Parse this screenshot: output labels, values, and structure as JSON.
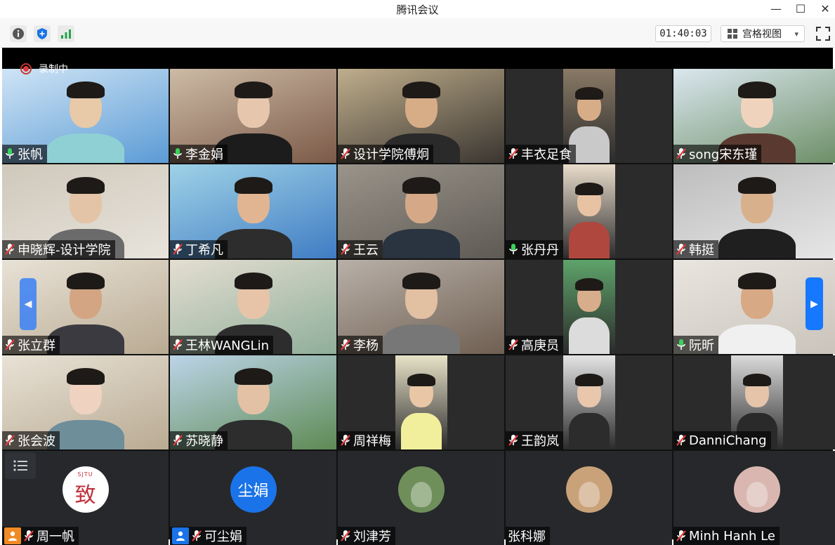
{
  "window": {
    "title": "腾讯会议",
    "minimize": "—",
    "maximize": "☐",
    "close": "✕"
  },
  "toolbar": {
    "timer": "01:40:03",
    "view_label": "宫格视图",
    "view_caret": "▾"
  },
  "recording": {
    "label": "录制中"
  },
  "participants": [
    {
      "name": "张帆",
      "mic": "on",
      "bg": "#5b9bd5",
      "bg2": "#cfe4f5",
      "skin": "#e8c9a8",
      "shirt": "#8fd0d4",
      "type": "video"
    },
    {
      "name": "李金娟",
      "mic": "on",
      "bg": "#7b5a48",
      "bg2": "#cdbba6",
      "skin": "#e6c7ae",
      "shirt": "#1c1c1c",
      "type": "video"
    },
    {
      "name": "设计学院傅炯",
      "mic": "off",
      "bg": "#3a3530",
      "bg2": "#bfae8c",
      "skin": "#d7ad88",
      "shirt": "#2a2a2a",
      "type": "video"
    },
    {
      "name": "丰衣足食",
      "mic": "off",
      "bg": "#2b2b2b",
      "bg2": "#8a7a66",
      "skin": "#d7ad88",
      "shirt": "#c9c9c9",
      "type": "narrow"
    },
    {
      "name": "song宋东瑾",
      "mic": "off",
      "bg": "#6c8e66",
      "bg2": "#dbe7ef",
      "skin": "#f0d3bd",
      "shirt": "#5a3a30",
      "type": "video"
    },
    {
      "name": "申晓辉-设计学院",
      "mic": "off",
      "bg": "#e8e4dc",
      "bg2": "#cfc8bb",
      "skin": "#e3c4a6",
      "shirt": "#6b6b6b",
      "type": "video"
    },
    {
      "name": "丁希凡",
      "mic": "off",
      "bg": "#3f7cc4",
      "bg2": "#9fd2e6",
      "skin": "#e2b592",
      "shirt": "#2d2d2d",
      "type": "video"
    },
    {
      "name": "王云",
      "mic": "off",
      "bg": "#5e5a54",
      "bg2": "#9a948a",
      "skin": "#d5a987",
      "shirt": "#2a3340",
      "type": "video"
    },
    {
      "name": "张丹丹",
      "mic": "on",
      "bg": "#2b2b2b",
      "bg2": "#e9dccb",
      "skin": "#e8c3a3",
      "shirt": "#b0473e",
      "type": "narrow"
    },
    {
      "name": "韩挺",
      "mic": "off",
      "bg": "#e6e6e6",
      "bg2": "#bdbdbd",
      "skin": "#d9b08c",
      "shirt": "#1f1f1f",
      "type": "video"
    },
    {
      "name": "张立群",
      "mic": "off",
      "bg": "#b9aa92",
      "bg2": "#e8e2d6",
      "skin": "#d3a583",
      "shirt": "#3a3a40",
      "type": "video"
    },
    {
      "name": "王林WANGLin",
      "mic": "off",
      "bg": "#8fae9a",
      "bg2": "#e4ded1",
      "skin": "#e7c4a8",
      "shirt": "#2d2d2d",
      "type": "video"
    },
    {
      "name": "李杨",
      "mic": "off",
      "bg": "#6f5f52",
      "bg2": "#b8b0a8",
      "skin": "#e2c0a2",
      "shirt": "#777777",
      "type": "video"
    },
    {
      "name": "高庚员",
      "mic": "off",
      "bg": "#2b2b2b",
      "bg2": "#5ea36a",
      "skin": "#d8ad8b",
      "shirt": "#dcdcdc",
      "type": "narrow"
    },
    {
      "name": "阮昕",
      "mic": "on",
      "bg": "#c9c3bb",
      "bg2": "#e9e5df",
      "skin": "#d8a985",
      "shirt": "#f0f0f0",
      "type": "video"
    },
    {
      "name": "张会波",
      "mic": "off",
      "bg": "#b9aa92",
      "bg2": "#e8e2d6",
      "skin": "#efd2c0",
      "shirt": "#6e8e9a",
      "type": "video"
    },
    {
      "name": "苏晓静",
      "mic": "off",
      "bg": "#5e8a54",
      "bg2": "#bcd4e8",
      "skin": "#e3c1a4",
      "shirt": "#2d2d2d",
      "type": "video"
    },
    {
      "name": "周祥梅",
      "mic": "off",
      "bg": "#2b2b2b",
      "bg2": "#e8e2c8",
      "skin": "#e9c6a6",
      "shirt": "#f1ef9c",
      "type": "narrow"
    },
    {
      "name": "王韵岚",
      "mic": "off",
      "bg": "#2b2b2b",
      "bg2": "#e4e4e4",
      "skin": "#e8c7ad",
      "shirt": "#2c2c2c",
      "type": "narrow"
    },
    {
      "name": "DanniChang",
      "mic": "off",
      "bg": "#2b2b2b",
      "bg2": "#dadada",
      "skin": "#e5c4aa",
      "shirt": "#2a2a2a",
      "type": "narrow"
    },
    {
      "name": "周一帆",
      "mic": "off",
      "type": "avatar",
      "avatar_text": "致",
      "avatar_sub": "SJTU",
      "avatar_bg": "#ffffff",
      "avatar_fg": "#c0303a",
      "host": "orange"
    },
    {
      "name": "可尘娟",
      "mic": "off",
      "type": "avatar",
      "avatar_text": "尘娟",
      "avatar_bg": "#1a73e8",
      "avatar_fg": "#ffffff",
      "host": "blue"
    },
    {
      "name": "刘津芳",
      "mic": "off",
      "type": "avatar",
      "avatar_text": "",
      "avatar_bg": "#6f8f5a",
      "avatar_fg": "#ffffff"
    },
    {
      "name": "张科娜",
      "mic": "none",
      "type": "avatar",
      "avatar_text": "",
      "avatar_bg": "#c9a27a",
      "avatar_fg": "#ffffff"
    },
    {
      "name": "Minh Hanh Le",
      "mic": "off",
      "type": "avatar",
      "avatar_text": "",
      "avatar_bg": "#d9b7b0",
      "avatar_fg": "#ffffff"
    }
  ]
}
